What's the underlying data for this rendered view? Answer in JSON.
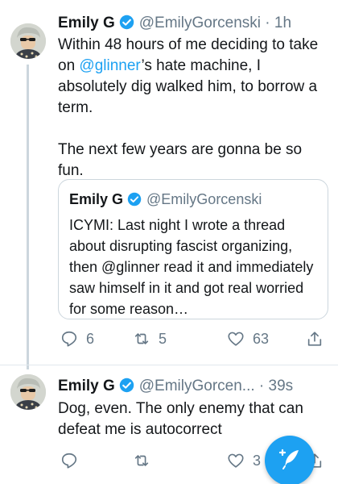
{
  "tweets": [
    {
      "name": "Emily G",
      "handle": "@EmilyGorcenski",
      "separator": "·",
      "time": "1h",
      "text_before_mention": "Within 48 hours of me deciding to take on ",
      "mention": "@glinner",
      "text_after_mention": "’s hate machine, I absolutely dig walked him, to borrow a term.",
      "text_second_paragraph": "The next few years are gonna be so fun.",
      "quote": {
        "name": "Emily G",
        "handle": "@EmilyGorcenski",
        "text": "ICYMI: Last night I wrote a thread about disrupting fascist organizing, then @glinner read it and immediately saw himself in it and got real worried for some reason…"
      },
      "actions": {
        "reply_count": "6",
        "retweet_count": "5",
        "like_count": "63"
      }
    },
    {
      "name": "Emily G",
      "handle": "@EmilyGorcen...",
      "separator": "·",
      "time": "39s",
      "text": "Dog, even. The only enemy that can defeat me is autocorrect",
      "actions": {
        "reply_count": "",
        "retweet_count": "",
        "like_count": "3"
      }
    }
  ],
  "icons": {
    "verified": "verified-badge-icon",
    "reply": "reply-icon",
    "retweet": "retweet-icon",
    "like": "heart-icon",
    "share": "share-icon",
    "compose": "compose-feather-icon"
  },
  "colors": {
    "accent": "#1da1f2",
    "secondary_text": "#657786",
    "border": "#ccd6dd"
  }
}
